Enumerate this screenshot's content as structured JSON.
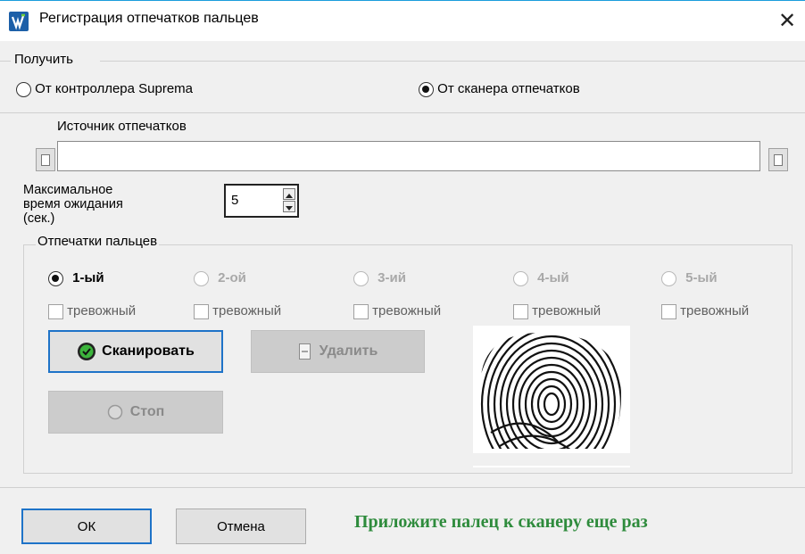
{
  "window": {
    "title": "Регистрация отпечатков пальцев"
  },
  "receive": {
    "group_label": "Получить",
    "options": [
      {
        "label": "От контроллера Suprema",
        "checked": false
      },
      {
        "label": "От сканера отпечатков",
        "checked": true
      }
    ]
  },
  "source": {
    "label": "Источник отпечатков",
    "value": ""
  },
  "timeout": {
    "label_lines": [
      "Максимальное",
      "время ожидания",
      "(сек.)"
    ],
    "value": "5"
  },
  "fingerprints": {
    "group_label": "Отпечатки пальцев",
    "fingers": [
      {
        "label": "1-ый",
        "checked": true,
        "enabled": true,
        "alarm_label": "тревожный"
      },
      {
        "label": "2-ой",
        "checked": false,
        "enabled": false,
        "alarm_label": "тревожный"
      },
      {
        "label": "3-ий",
        "checked": false,
        "enabled": false,
        "alarm_label": "тревожный"
      },
      {
        "label": "4-ый",
        "checked": false,
        "enabled": false,
        "alarm_label": "тревожный"
      },
      {
        "label": "5-ый",
        "checked": false,
        "enabled": false,
        "alarm_label": "тревожный"
      }
    ],
    "scan_label": "Сканировать",
    "delete_label": "Удалить",
    "stop_label": "Стоп"
  },
  "footer": {
    "ok_label": "ОК",
    "cancel_label": "Отмена",
    "status_text": "Приложите палец к сканеру еще раз",
    "status_color": "#2e8b3c"
  }
}
